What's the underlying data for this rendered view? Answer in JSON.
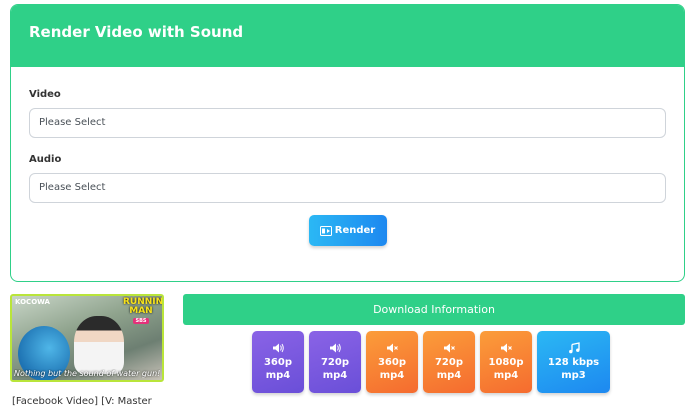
{
  "form": {
    "title": "Render Video with Sound",
    "video_label": "Video",
    "video_placeholder": "Please Select",
    "audio_label": "Audio",
    "audio_placeholder": "Please Select",
    "render_label": "Render"
  },
  "result": {
    "thumbnail": {
      "logo_left": "KOCOWA",
      "logo_right_line1": "RUNNING",
      "logo_right_line2": "MAN",
      "logo_right_tag": "SBS",
      "caption": "Nothing but the sound of water gun!"
    },
    "video_title": "[Facebook Video] [V: Master",
    "download_header": "Download Information",
    "downloads": [
      {
        "quality": "360p",
        "format": "mp4",
        "icon": "volume-icon",
        "color": "#7b5ae0"
      },
      {
        "quality": "720p",
        "format": "mp4",
        "icon": "volume-icon",
        "color": "#7b5ae0"
      },
      {
        "quality": "360p",
        "format": "mp4",
        "icon": "mute-icon",
        "color": "#f7812f"
      },
      {
        "quality": "720p",
        "format": "mp4",
        "icon": "mute-icon",
        "color": "#f7812f"
      },
      {
        "quality": "1080p",
        "format": "mp4",
        "icon": "mute-icon",
        "color": "#f7812f"
      },
      {
        "quality": "128 kbps",
        "format": "mp3",
        "icon": "music-note-icon",
        "color": "#1d9af2"
      }
    ]
  },
  "colors": {
    "accent": "#2fd088",
    "primary": "#1d88f0"
  }
}
